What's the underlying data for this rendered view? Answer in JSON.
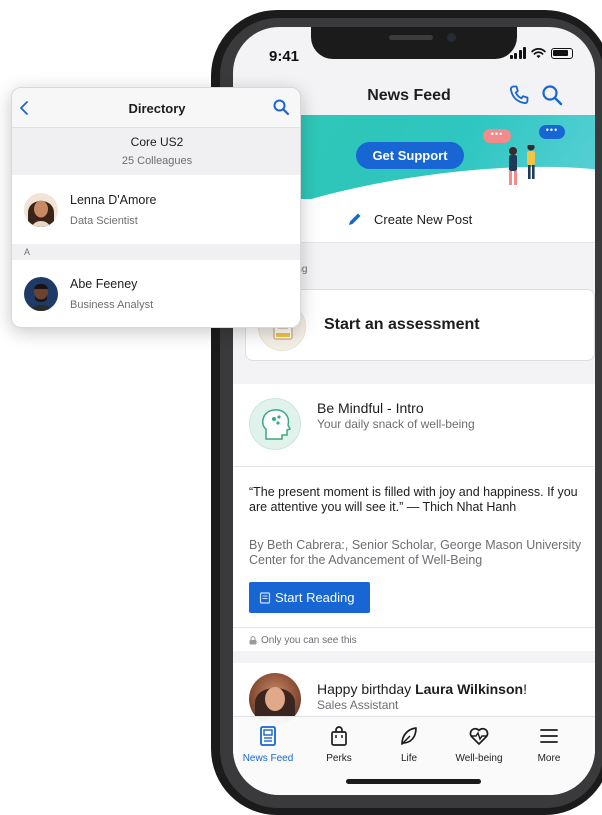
{
  "status": {
    "time": "9:41"
  },
  "header": {
    "title": "News Feed"
  },
  "banner": {
    "button_label": "Get Support"
  },
  "create_post": {
    "label": "Create New Post"
  },
  "wellbeing_section": {
    "label": "being"
  },
  "assessment": {
    "title": "Start an assessment"
  },
  "mindful": {
    "title": "Be Mindful - Intro",
    "subtitle": "Your daily snack of well-being",
    "quote": "“The present moment is filled with joy and happiness. If you are attentive you will see it.” — Thich Nhat Hanh",
    "byline": "By Beth Cabrera:, Senior Scholar, George Mason University Center for the Advancement of Well-Being",
    "button_label": "Start Reading",
    "privacy_note": "Only you can see this"
  },
  "birthday": {
    "prefix": "Happy birthday ",
    "name": "Laura Wilkinson",
    "suffix": "!",
    "role": "Sales Assistant"
  },
  "tabs": [
    {
      "label": "News Feed",
      "icon": "news-feed-icon",
      "active": true
    },
    {
      "label": "Perks",
      "icon": "shopping-bag-icon",
      "active": false
    },
    {
      "label": "Life",
      "icon": "leaf-icon",
      "active": false
    },
    {
      "label": "Well-being",
      "icon": "heartbeat-icon",
      "active": false
    },
    {
      "label": "More",
      "icon": "menu-icon",
      "active": false
    }
  ],
  "directory": {
    "title": "Directory",
    "group_name": "Core US2",
    "group_count": "25 Colleagues",
    "section_letter": "A",
    "people": [
      {
        "name": "Lenna D'Amore",
        "role": "Data Scientist"
      },
      {
        "name": "Abe Feeney",
        "role": "Business Analyst"
      }
    ]
  },
  "colors": {
    "accent": "#1766d3",
    "banner": "#2fc7b3"
  }
}
